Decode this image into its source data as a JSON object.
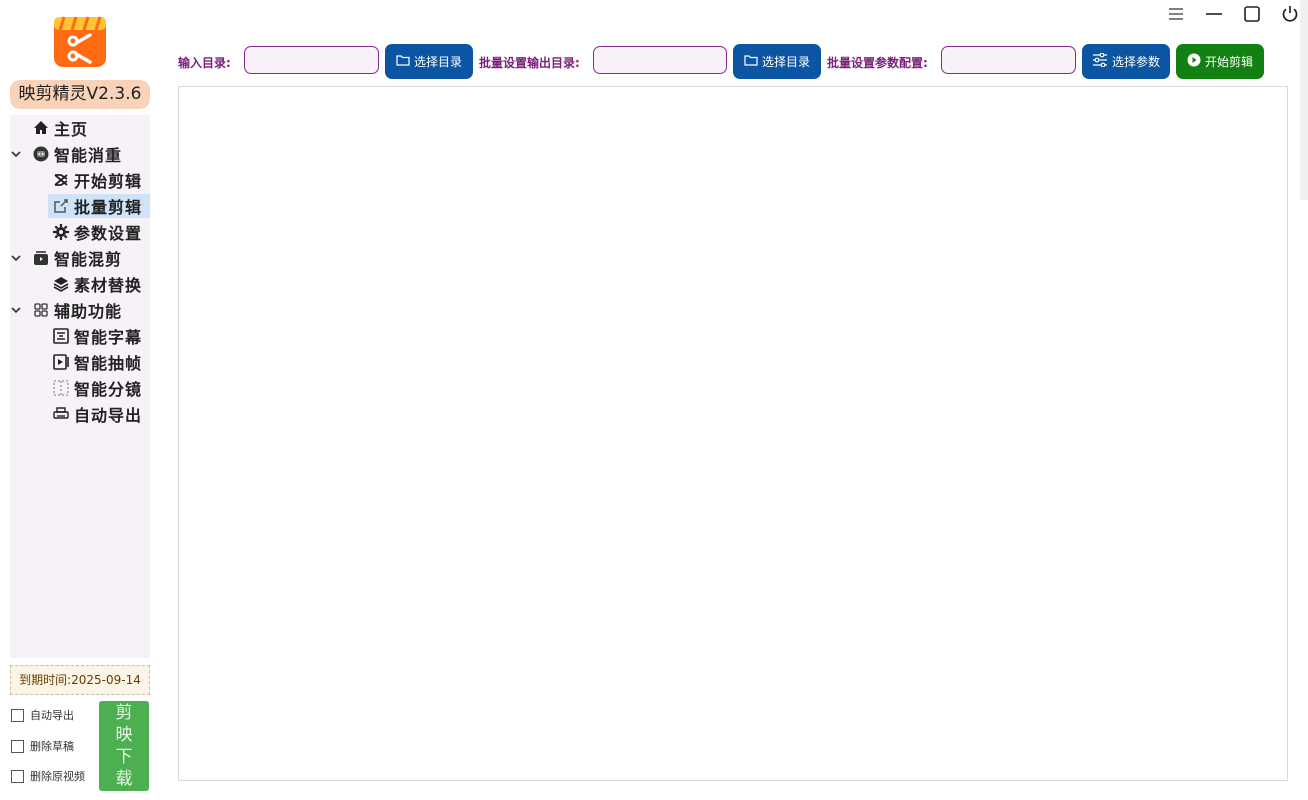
{
  "app": {
    "version_label": "映剪精灵V2.3.6",
    "brand_color": "#ff6a13"
  },
  "window_controls": [
    "menu-icon",
    "minimize-icon",
    "maximize-icon",
    "power-icon"
  ],
  "nav": {
    "home": "主页",
    "group1": "智能消重",
    "start_edit": "开始剪辑",
    "batch_edit": "批量剪辑",
    "param_settings": "参数设置",
    "group2": "智能混剪",
    "material_replace": "素材替换",
    "group3": "辅助功能",
    "smart_subtitle": "智能字幕",
    "smart_frame": "智能抽帧",
    "smart_scene": "智能分镜",
    "auto_export": "自动导出"
  },
  "footer": {
    "expire_label": "到期时间:2025-09-14",
    "opt_auto_export": "自动导出",
    "opt_delete_draft": "删除草稿",
    "opt_delete_source": "删除原视频",
    "download_chars": [
      "剪",
      "映",
      "下",
      "载"
    ]
  },
  "toolbar": {
    "input_dir_label": "输入目录:",
    "input_dir_value": "",
    "select_dir_1": "选择目录",
    "output_dir_label": "批量设置输出目录:",
    "output_dir_value": "",
    "select_dir_2": "选择目录",
    "param_config_label": "批量设置参数配置:",
    "param_config_value": "",
    "select_params": "选择参数",
    "start_edit": "开始剪辑"
  }
}
